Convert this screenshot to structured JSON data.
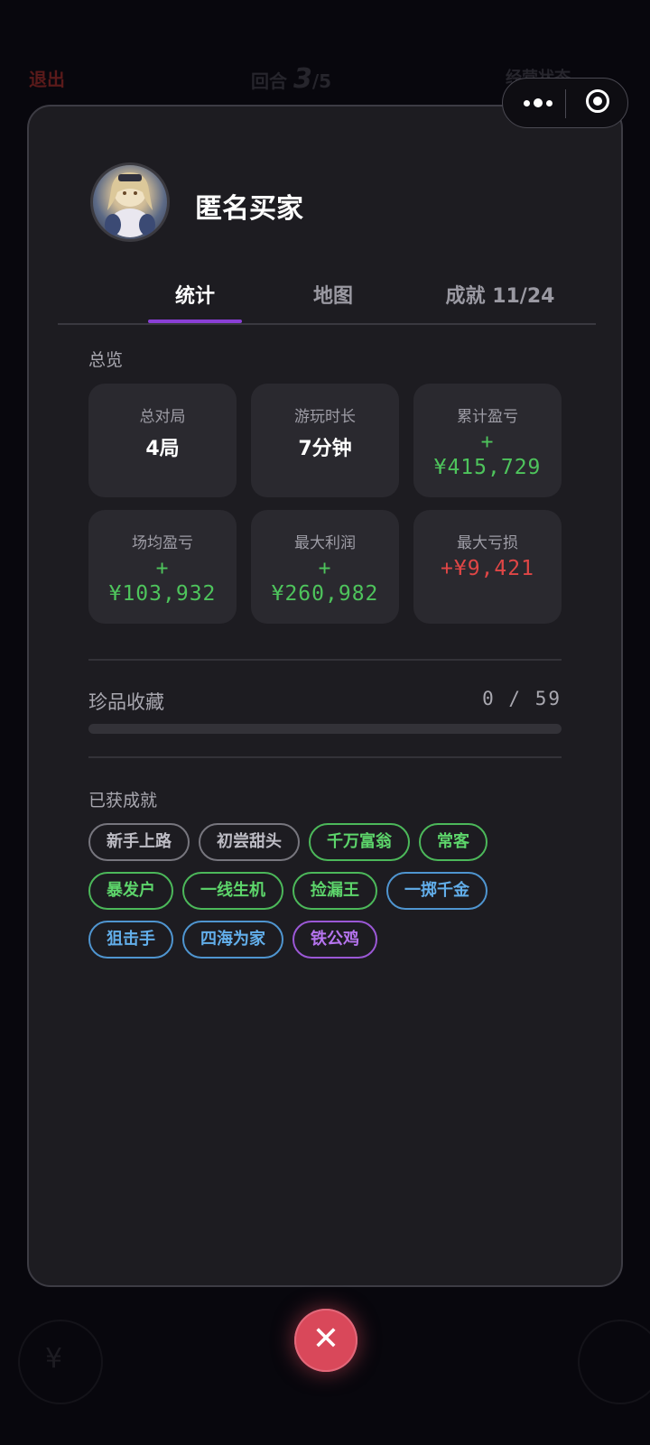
{
  "background": {
    "exit_label": "退出",
    "round_label": "回合",
    "round_number": "3",
    "round_total": "/5",
    "right_label": "经营状态",
    "bottom_icon": "¥"
  },
  "capsule": {
    "more_icon": "more-dots-icon",
    "close_icon": "target-circle-icon"
  },
  "profile": {
    "name": "匿名买家",
    "avatar_icon": "anime-avatar"
  },
  "tabs": [
    {
      "label": "统计",
      "active": true
    },
    {
      "label": "地图",
      "active": false
    },
    {
      "label": "成就 11/24",
      "active": false
    }
  ],
  "overview": {
    "title": "总览",
    "cards": [
      {
        "label": "总对局",
        "value": "4局"
      },
      {
        "label": "游玩时长",
        "value": "7分钟"
      },
      {
        "label": "累计盈亏",
        "sign": "+",
        "value": "¥415,729",
        "color": "#4ec45c"
      },
      {
        "label": "场均盈亏",
        "sign": "+",
        "value": "¥103,932",
        "color": "#4ec45c"
      },
      {
        "label": "最大利润",
        "sign": "+",
        "value": "¥260,982",
        "color": "#4ec45c"
      },
      {
        "label": "最大亏损",
        "value": "+¥9,421",
        "color": "#e04646"
      }
    ]
  },
  "collection": {
    "label": "珍品收藏",
    "count_text": "0 / 59",
    "progress_fraction": 0
  },
  "achievements": {
    "title": "已获成就",
    "badges": [
      {
        "label": "新手上路",
        "tier": "gray"
      },
      {
        "label": "初尝甜头",
        "tier": "gray"
      },
      {
        "label": "千万富翁",
        "tier": "green"
      },
      {
        "label": "常客",
        "tier": "green"
      },
      {
        "label": "暴发户",
        "tier": "green"
      },
      {
        "label": "一线生机",
        "tier": "green"
      },
      {
        "label": "捡漏王",
        "tier": "green"
      },
      {
        "label": "一掷千金",
        "tier": "blue"
      },
      {
        "label": "狙击手",
        "tier": "blue"
      },
      {
        "label": "四海为家",
        "tier": "blue"
      },
      {
        "label": "铁公鸡",
        "tier": "purple"
      }
    ]
  },
  "close_button": {
    "icon": "close-x-icon",
    "glyph": "✕"
  },
  "colors": {
    "accent": "#8a3fd6",
    "profit": "#4ec45c",
    "loss": "#e04646",
    "close": "#d9485a"
  }
}
